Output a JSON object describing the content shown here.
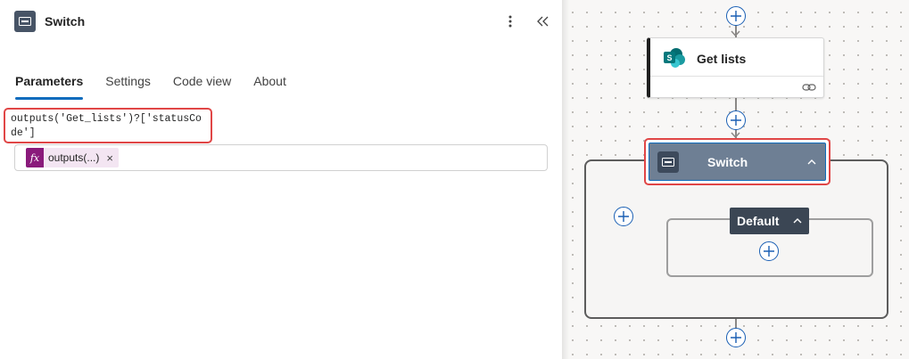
{
  "panel": {
    "title": "Switch",
    "tabs": [
      {
        "label": "Parameters",
        "active": true
      },
      {
        "label": "Settings",
        "active": false
      },
      {
        "label": "Code view",
        "active": false
      },
      {
        "label": "About",
        "active": false
      }
    ],
    "expression_tooltip": "outputs('Get_lists')?['statusCode']",
    "token": {
      "icon": "fx",
      "label": "outputs(...)",
      "remove": "×"
    }
  },
  "canvas": {
    "get_lists": {
      "title": "Get lists",
      "icon": "sharepoint-icon"
    },
    "switch_node": {
      "title": "Switch",
      "icon": "switch-icon"
    },
    "default_case": {
      "title": "Default"
    }
  },
  "colors": {
    "accent": "#0f6cbd",
    "highlight": "#e04646",
    "switch_node_bg": "#6e7f94",
    "token_fx": "#8a1a7b"
  }
}
